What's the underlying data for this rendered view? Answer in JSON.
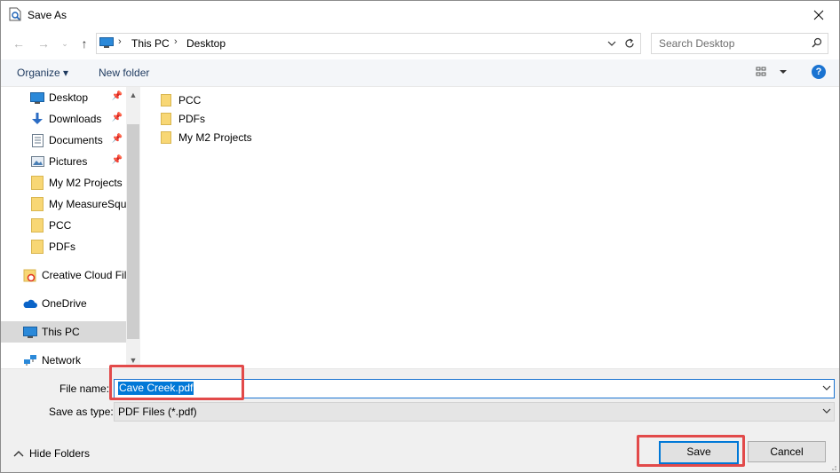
{
  "window": {
    "title": "Save As"
  },
  "address_bar": {
    "crumbs": [
      "This PC",
      "Desktop"
    ]
  },
  "search": {
    "placeholder": "Search Desktop"
  },
  "toolbar": {
    "organize_label": "Organize ▾",
    "new_folder_label": "New folder"
  },
  "nav_pane": {
    "items": [
      {
        "label": "Desktop",
        "icon": "desktop-icon",
        "pinned": true
      },
      {
        "label": "Downloads",
        "icon": "download-icon",
        "pinned": true
      },
      {
        "label": "Documents",
        "icon": "documents-icon",
        "pinned": true
      },
      {
        "label": "Pictures",
        "icon": "pictures-icon",
        "pinned": true
      },
      {
        "label": "My M2 Projects",
        "icon": "folder-icon",
        "pinned": false
      },
      {
        "label": "My MeasureSqu",
        "icon": "folder-icon",
        "pinned": false
      },
      {
        "label": "PCC",
        "icon": "folder-icon",
        "pinned": false
      },
      {
        "label": "PDFs",
        "icon": "folder-icon",
        "pinned": false
      },
      {
        "label": "Creative Cloud Fil",
        "icon": "creative-cloud-icon",
        "pinned": false
      },
      {
        "label": "OneDrive",
        "icon": "cloud-icon",
        "pinned": false
      },
      {
        "label": "This PC",
        "icon": "computer-icon",
        "pinned": false,
        "selected": true
      },
      {
        "label": "Network",
        "icon": "network-icon",
        "pinned": false
      }
    ]
  },
  "files": [
    {
      "name": "PCC",
      "icon": "folder-icon"
    },
    {
      "name": "PDFs",
      "icon": "folder-icon"
    },
    {
      "name": "My M2 Projects",
      "icon": "folder-icon"
    }
  ],
  "form": {
    "file_name_label": "File name:",
    "file_name_value": "Cave Creek.pdf",
    "save_as_type_label": "Save as type:",
    "save_as_type_value": "PDF Files (*.pdf)"
  },
  "footer": {
    "hide_folders_label": "Hide Folders",
    "save_label": "Save",
    "cancel_label": "Cancel"
  },
  "colors": {
    "accent": "#0078d7",
    "highlight_box": "#e24a4a",
    "folder": "#f8d775"
  }
}
